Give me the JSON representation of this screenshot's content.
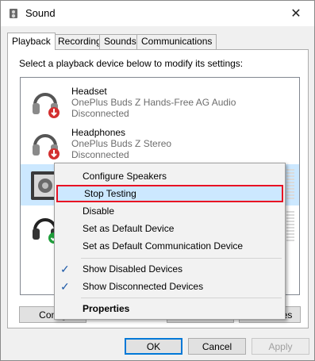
{
  "window": {
    "title": "Sound",
    "close_glyph": "✕"
  },
  "tabs": [
    {
      "label": "Playback"
    },
    {
      "label": "Recording"
    },
    {
      "label": "Sounds"
    },
    {
      "label": "Communications"
    }
  ],
  "panel": {
    "instruction": "Select a playback device below to modify its settings:"
  },
  "devices": [
    {
      "name": "Headset",
      "description": "OnePlus Buds Z Hands-Free AG Audio",
      "status": "Disconnected",
      "icon": "headset-icon",
      "badge": "disconnected-badge"
    },
    {
      "name": "Headphones",
      "description": "OnePlus Buds Z Stereo",
      "status": "Disconnected",
      "icon": "headphones-icon",
      "badge": "disconnected-badge"
    },
    {
      "name": "",
      "description": "",
      "status": "",
      "icon": "speaker-icon",
      "selected": true
    },
    {
      "name": "",
      "description": "",
      "status": "",
      "icon": "headphones-icon",
      "badge": "default-check-badge"
    }
  ],
  "buttons": {
    "configure": "Config",
    "set_default": "",
    "properties": "es",
    "ok": "OK",
    "cancel": "Cancel",
    "apply": "Apply"
  },
  "context_menu": {
    "items": [
      {
        "label": "Configure Speakers"
      },
      {
        "label": "Stop Testing",
        "highlighted": true
      },
      {
        "label": "Disable"
      },
      {
        "label": "Set as Default Device"
      },
      {
        "label": "Set as Default Communication Device"
      },
      {
        "label": "Show Disabled Devices",
        "checked": true
      },
      {
        "label": "Show Disconnected Devices",
        "checked": true
      },
      {
        "label": "Properties",
        "bold": true
      }
    ],
    "check_glyph": "✓"
  },
  "colors": {
    "highlight_border": "#e81123",
    "selection": "#cce8ff",
    "accent": "#0078d7"
  }
}
